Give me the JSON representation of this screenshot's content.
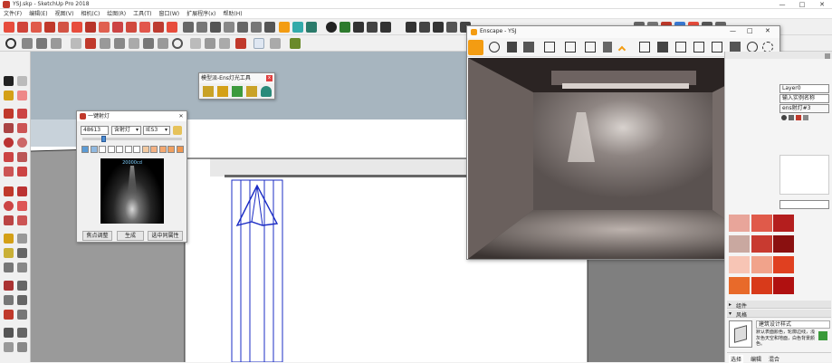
{
  "window": {
    "title": "YSJ.skp - SketchUp Pro 2018",
    "minimize": "—",
    "maximize": "□",
    "close": "✕"
  },
  "menu": [
    "文件(F)",
    "编辑(E)",
    "视图(V)",
    "相机(C)",
    "绘图(R)",
    "工具(T)",
    "窗口(W)",
    "扩展程序(x)",
    "帮助(H)"
  ],
  "ens_toolbar": {
    "title": "模型派-Ens灯光工具",
    "close": "x"
  },
  "light_dialog": {
    "title": "一键射灯",
    "value_input": "48613",
    "type_select": "含射灯",
    "ies_select": "IES3",
    "preview_label": "20000cd",
    "buttons": {
      "focus": "焦点调整",
      "generate": "生成",
      "select": "选中同属性"
    },
    "swatch_colors": [
      "#5b9bd5",
      "#8fb8e0",
      "#ffffff",
      "#ffffff",
      "#ffffff",
      "#ffffff",
      "#ffffff",
      "#f2c9a0",
      "#f4b183",
      "#f4a870",
      "#f0a060",
      "#ee9650"
    ]
  },
  "enscape": {
    "title": "Enscape - YSJ",
    "window_buttons": {
      "min": "—",
      "max": "□",
      "close": "✕"
    }
  },
  "right_panel": {
    "layer": "Layer0",
    "name_field": "输入实例名称",
    "definition": "ens射灯#3",
    "sections": {
      "materials": "组件",
      "styles": "风格"
    },
    "style_name": "建筑设计样式",
    "style_desc": "默认表面颜色，轮廓边线，浅灰色天空和地面，白色背景颜色。",
    "tabs": [
      "选择",
      "编辑",
      "混合"
    ],
    "red_swatches": [
      "#e8a59a",
      "#e05a4a",
      "#b41e1e",
      "#c9a8a0",
      "#c83a30",
      "#8a1010",
      "#f7c5b5",
      "#f1a38b",
      "#e04020",
      "#e86a2a",
      "#d83a1a",
      "#b01010"
    ]
  }
}
